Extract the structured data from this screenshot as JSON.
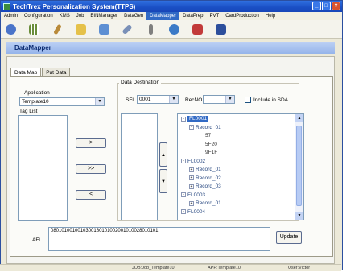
{
  "window": {
    "title": "TechTrex Personalization System(TTPS)"
  },
  "menu": [
    "Admin",
    "Configuration",
    "KMS",
    "Job",
    "BINManager",
    "DataGen",
    "DataMapper",
    "DataPrep",
    "PVT",
    "CardProduction",
    "Help"
  ],
  "menu_active": "DataMapper",
  "toolbar_icons": [
    "user-icon",
    "grid-icon",
    "tools-icon",
    "folder-icon",
    "home-icon",
    "plane-icon",
    "wrench-icon",
    "clock-icon",
    "check-icon",
    "book-icon"
  ],
  "panel": {
    "title": "DataMapper"
  },
  "tabs": [
    "Data Map",
    "Put Data"
  ],
  "application": {
    "label": "Application",
    "value": "Template10"
  },
  "taglist": {
    "label": "Tag List"
  },
  "buttons": {
    "single_right": ">",
    "all_right": ">>",
    "single_left": "<",
    "up": "▲",
    "down": "▼",
    "update": "Update"
  },
  "destination": {
    "title": "Data Destination",
    "sfi_label": "SFI",
    "sfi_value": "0001",
    "recno_label": "RecNO",
    "recno_value": "",
    "include_sda_label": "Include in SDA"
  },
  "tree": [
    {
      "label": "FL0001",
      "level": 0,
      "toggle": "-",
      "selected": true
    },
    {
      "label": "Record_01",
      "level": 1,
      "toggle": "-"
    },
    {
      "label": "57",
      "level": 2,
      "toggle": ""
    },
    {
      "label": "5F20",
      "level": 2,
      "toggle": ""
    },
    {
      "label": "9F1F",
      "level": 2,
      "toggle": ""
    },
    {
      "label": "FL0002",
      "level": 0,
      "toggle": "-"
    },
    {
      "label": "Record_01",
      "level": 1,
      "toggle": "+"
    },
    {
      "label": "Record_02",
      "level": 1,
      "toggle": "+"
    },
    {
      "label": "Record_03",
      "level": 1,
      "toggle": "+"
    },
    {
      "label": "FL0003",
      "level": 0,
      "toggle": "-"
    },
    {
      "label": "Record_01",
      "level": 1,
      "toggle": "+"
    },
    {
      "label": "FL0004",
      "level": 0,
      "toggle": "-"
    }
  ],
  "afl": {
    "label": "AFL",
    "value": "0801010010010300180101002001010028010101"
  },
  "status": {
    "job": "JOB:Job_Template10",
    "app": "APP:Template10",
    "user": "User:Victor"
  },
  "colors": {
    "title_bar": "#1a4fc4",
    "panel_header": "#95b4ea",
    "selection": "#316ac5"
  }
}
